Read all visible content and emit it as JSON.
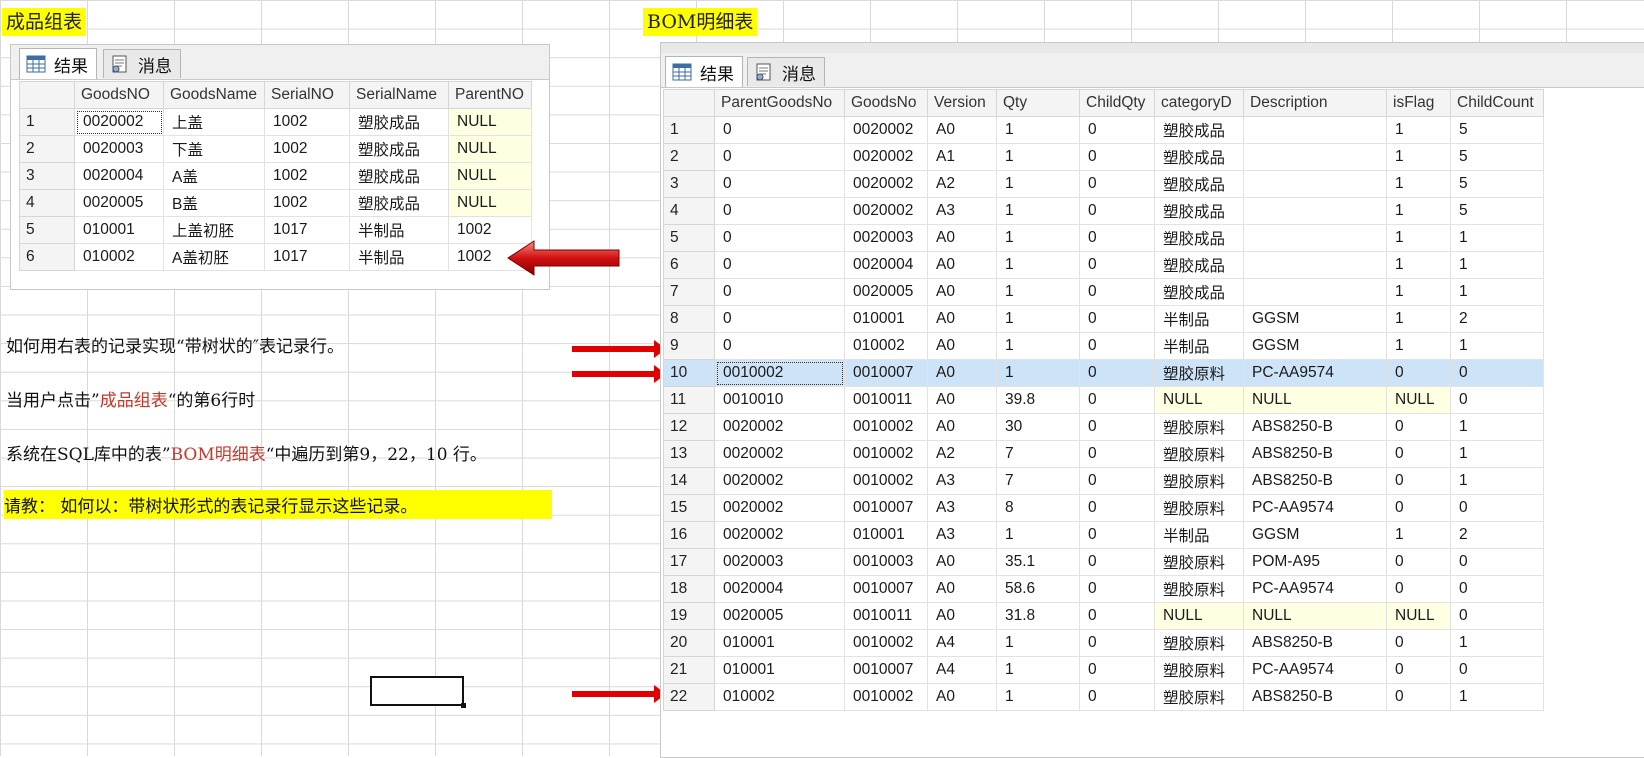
{
  "left_label": "成品组表",
  "right_label": "BOM明细表",
  "tabs": {
    "results": "结果",
    "messages": "消息"
  },
  "left_table": {
    "columns": [
      "GoodsNO",
      "GoodsName",
      "SerialNO",
      "SerialName",
      "ParentNO"
    ],
    "rows": [
      [
        "1",
        "0020002",
        "上盖",
        "1002",
        "塑胶成品",
        "NULL"
      ],
      [
        "2",
        "0020003",
        "下盖",
        "1002",
        "塑胶成品",
        "NULL"
      ],
      [
        "3",
        "0020004",
        "A盖",
        "1002",
        "塑胶成品",
        "NULL"
      ],
      [
        "4",
        "0020005",
        "B盖",
        "1002",
        "塑胶成品",
        "NULL"
      ],
      [
        "5",
        "010001",
        "上盖初胚",
        "1017",
        "半制品",
        "1002"
      ],
      [
        "6",
        "010002",
        "A盖初胚",
        "1017",
        "半制品",
        "1002"
      ]
    ]
  },
  "right_table": {
    "columns": [
      "ParentGoodsNo",
      "GoodsNo",
      "Version",
      "Qty",
      "ChildQty",
      "categoryD",
      "Description",
      "isFlag",
      "ChildCount"
    ],
    "rows": [
      [
        "1",
        "0",
        "0020002",
        "A0",
        "1",
        "0",
        "塑胶成品",
        "",
        "1",
        "5"
      ],
      [
        "2",
        "0",
        "0020002",
        "A1",
        "1",
        "0",
        "塑胶成品",
        "",
        "1",
        "5"
      ],
      [
        "3",
        "0",
        "0020002",
        "A2",
        "1",
        "0",
        "塑胶成品",
        "",
        "1",
        "5"
      ],
      [
        "4",
        "0",
        "0020002",
        "A3",
        "1",
        "0",
        "塑胶成品",
        "",
        "1",
        "5"
      ],
      [
        "5",
        "0",
        "0020003",
        "A0",
        "1",
        "0",
        "塑胶成品",
        "",
        "1",
        "1"
      ],
      [
        "6",
        "0",
        "0020004",
        "A0",
        "1",
        "0",
        "塑胶成品",
        "",
        "1",
        "1"
      ],
      [
        "7",
        "0",
        "0020005",
        "A0",
        "1",
        "0",
        "塑胶成品",
        "",
        "1",
        "1"
      ],
      [
        "8",
        "0",
        "010001",
        "A0",
        "1",
        "0",
        "半制品",
        "GGSM",
        "1",
        "2"
      ],
      [
        "9",
        "0",
        "010002",
        "A0",
        "1",
        "0",
        "半制品",
        "GGSM",
        "1",
        "1"
      ],
      [
        "10",
        "0010002",
        "0010007",
        "A0",
        "1",
        "0",
        "塑胶原料",
        "PC-AA9574",
        "0",
        "0"
      ],
      [
        "11",
        "0010010",
        "0010011",
        "A0",
        "39.8",
        "0",
        "NULL",
        "NULL",
        "NULL",
        "0"
      ],
      [
        "12",
        "0020002",
        "0010002",
        "A0",
        "30",
        "0",
        "塑胶原料",
        "ABS8250-B",
        "0",
        "1"
      ],
      [
        "13",
        "0020002",
        "0010002",
        "A2",
        "7",
        "0",
        "塑胶原料",
        "ABS8250-B",
        "0",
        "1"
      ],
      [
        "14",
        "0020002",
        "0010002",
        "A3",
        "7",
        "0",
        "塑胶原料",
        "ABS8250-B",
        "0",
        "1"
      ],
      [
        "15",
        "0020002",
        "0010007",
        "A3",
        "8",
        "0",
        "塑胶原料",
        "PC-AA9574",
        "0",
        "0"
      ],
      [
        "16",
        "0020002",
        "010001",
        "A3",
        "1",
        "0",
        "半制品",
        "GGSM",
        "1",
        "2"
      ],
      [
        "17",
        "0020003",
        "0010003",
        "A0",
        "35.1",
        "0",
        "塑胶原料",
        "POM-A95",
        "0",
        "0"
      ],
      [
        "18",
        "0020004",
        "0010007",
        "A0",
        "58.6",
        "0",
        "塑胶原料",
        "PC-AA9574",
        "0",
        "0"
      ],
      [
        "19",
        "0020005",
        "0010011",
        "A0",
        "31.8",
        "0",
        "NULL",
        "NULL",
        "NULL",
        "0"
      ],
      [
        "20",
        "010001",
        "0010002",
        "A4",
        "1",
        "0",
        "塑胶原料",
        "ABS8250-B",
        "0",
        "1"
      ],
      [
        "21",
        "010001",
        "0010007",
        "A4",
        "1",
        "0",
        "塑胶原料",
        "PC-AA9574",
        "0",
        "0"
      ],
      [
        "22",
        "010002",
        "0010002",
        "A0",
        "1",
        "0",
        "塑胶原料",
        "ABS8250-B",
        "0",
        "1"
      ]
    ]
  },
  "notes": {
    "line1": "如何用右表的记录实现“带树状的″表记录行。",
    "line2_pre": "当用户点击”",
    "line2_red": "成品组表",
    "line2_post": "“的第6行时",
    "line3_pre": "系统在SQL库中的表”",
    "line3_red": "BOM明细表",
    "line3_post": "“中遍历到第9，22，10 行。",
    "line4": "请教：    如何以：带树状形式的表记录行显示这些记录。"
  },
  "colors": {
    "highlight": "#ffff00",
    "arrow": "#e00000",
    "selected_row": "#cde3f8",
    "null_cell": "#ffffe1",
    "red_text": "#c0392b"
  }
}
